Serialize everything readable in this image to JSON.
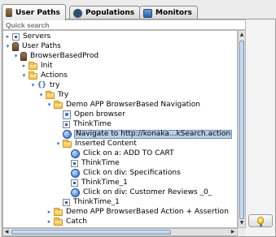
{
  "tabs": [
    {
      "label": "User Paths",
      "icon": "bottle-icon",
      "active": true
    },
    {
      "label": "Populations",
      "icon": "populations-icon",
      "active": false
    },
    {
      "label": "Monitors",
      "icon": "monitors-icon",
      "active": false
    }
  ],
  "search": {
    "placeholder": "Quick search"
  },
  "tree": [
    {
      "label": "Servers",
      "icon": "server-icon",
      "toggle": "collapsed"
    },
    {
      "label": "User Paths",
      "icon": "bottle-icon",
      "toggle": "expanded"
    },
    {
      "label": "BrowserBasedProd",
      "icon": "bottle-icon",
      "toggle": "expanded"
    },
    {
      "label": "Init",
      "icon": "folder-icon",
      "toggle": "collapsed"
    },
    {
      "label": "Actions",
      "icon": "folder-icon",
      "toggle": "expanded"
    },
    {
      "label": "try",
      "icon": "braces-icon",
      "toggle": "expanded"
    },
    {
      "label": "Try",
      "icon": "folder-icon",
      "toggle": "expanded"
    },
    {
      "label": "Demo APP BrowserBased Navigation",
      "icon": "folder-icon",
      "toggle": "expanded"
    },
    {
      "label": "Open browser",
      "icon": "page-icon",
      "toggle": "none"
    },
    {
      "label": "ThinkTime",
      "icon": "think-icon",
      "toggle": "none"
    },
    {
      "label": "Navigate to http://konaka...kSearch.action",
      "icon": "globe-icon",
      "toggle": "none",
      "selected": true
    },
    {
      "label": "Inserted Content",
      "icon": "folder-icon",
      "toggle": "expanded"
    },
    {
      "label": "Click on a: ADD TO CART",
      "icon": "globe-icon",
      "toggle": "none"
    },
    {
      "label": "ThinkTime",
      "icon": "think-icon",
      "toggle": "none"
    },
    {
      "label": "Click on div: Specifications",
      "icon": "globe-icon",
      "toggle": "none"
    },
    {
      "label": "ThinkTime_1",
      "icon": "think-icon",
      "toggle": "none"
    },
    {
      "label": "Click on div: Customer Reviews _0_",
      "icon": "globe-icon",
      "toggle": "none"
    },
    {
      "label": "ThinkTime_1",
      "icon": "think-icon",
      "toggle": "none"
    },
    {
      "label": "Demo APP BrowserBased Action + Assertion",
      "icon": "folder-icon",
      "toggle": "collapsed"
    },
    {
      "label": "Catch",
      "icon": "folder-icon",
      "toggle": "collapsed"
    }
  ],
  "toggle_glyphs": {
    "expanded": "▾",
    "collapsed": "▸",
    "none": ""
  },
  "colors": {
    "selection": "#b8cfe5",
    "accent": "#2a66b8"
  },
  "side_button": {
    "icon": "lightbulb-icon"
  }
}
